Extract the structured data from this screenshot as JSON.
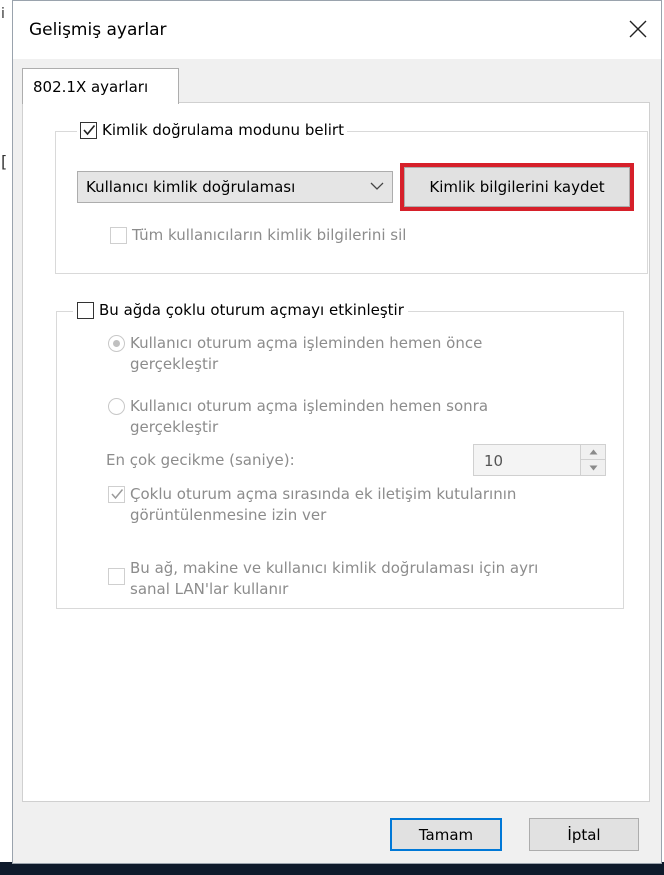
{
  "window": {
    "title": "Gelişmiş ayarlar",
    "close_icon": "close-icon"
  },
  "tabs": [
    {
      "label": "802.1X ayarları",
      "selected": true
    }
  ],
  "auth_group": {
    "specify_mode_label": "Kimlik doğrulama modunu belirt",
    "specify_mode_checked": true,
    "mode_select_value": "Kullanıcı kimlik doğrulaması",
    "save_credentials_label": "Kimlik bilgilerini kaydet",
    "delete_all_label": "Tüm kullanıcıların kimlik bilgilerini sil",
    "delete_all_checked": false
  },
  "sso_group": {
    "enable_label": "Bu ağda çoklu oturum açmayı etkinleştir",
    "enable_checked": false,
    "before_logon_label_1": "Kullanıcı oturum açma işleminden hemen önce",
    "before_logon_label_2": "gerçekleştir",
    "before_logon_selected": true,
    "after_logon_label_1": "Kullanıcı oturum açma işleminden hemen sonra",
    "after_logon_label_2": "gerçekleştir",
    "after_logon_selected": false,
    "max_delay_label": "En çok gecikme (saniye):",
    "max_delay_value": "10",
    "allow_dialogs_label_1": "Çoklu oturum açma sırasında ek iletişim kutularının",
    "allow_dialogs_label_2": "görüntülenmesine izin ver",
    "allow_dialogs_checked": true,
    "separate_vlans_label_1": "Bu ağ, makine ve kullanıcı kimlik doğrulaması için ayrı",
    "separate_vlans_label_2": "sanal LAN'lar kullanır",
    "separate_vlans_checked": false
  },
  "footer": {
    "ok_label": "Tamam",
    "cancel_label": "İptal"
  },
  "colors": {
    "highlight_red": "#d6202a",
    "focus_blue": "#0078d7"
  }
}
